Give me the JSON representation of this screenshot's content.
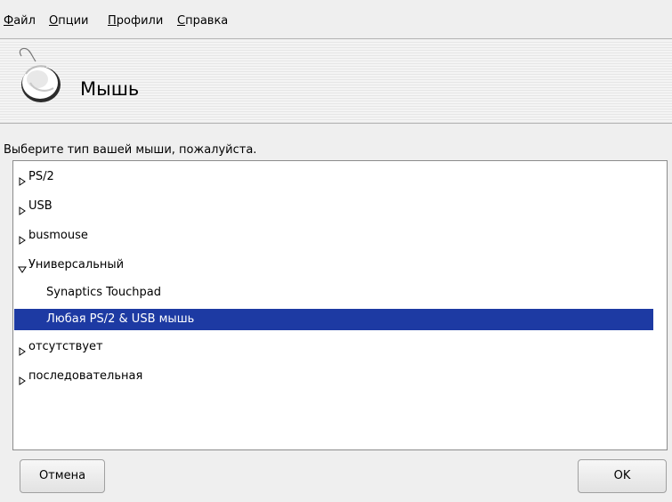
{
  "menubar": {
    "items": [
      {
        "mnemonic": "Ф",
        "rest": "айл"
      },
      {
        "mnemonic": "О",
        "rest": "пции"
      },
      {
        "mnemonic": "П",
        "rest": "рофили"
      },
      {
        "mnemonic": "С",
        "rest": "правка"
      }
    ]
  },
  "banner": {
    "icon": "mouse-icon",
    "title": "Мышь"
  },
  "prompt": "Выберите тип вашей мыши, пожалуйста.",
  "tree": {
    "items": [
      {
        "label": "PS/2",
        "state": "collapsed"
      },
      {
        "label": "USB",
        "state": "collapsed"
      },
      {
        "label": "busmouse",
        "state": "collapsed"
      },
      {
        "label": "Универсальный",
        "state": "expanded"
      },
      {
        "label": "Synaptics Touchpad",
        "state": "child"
      },
      {
        "label": "Любая PS/2 & USB мышь",
        "state": "child-selected"
      },
      {
        "label": "отсутствует",
        "state": "collapsed"
      },
      {
        "label": "последовательная",
        "state": "collapsed"
      }
    ]
  },
  "buttons": {
    "cancel": "Отмена",
    "ok": "OK"
  },
  "colors": {
    "selection": "#1d3aa3",
    "background": "#efefef"
  }
}
